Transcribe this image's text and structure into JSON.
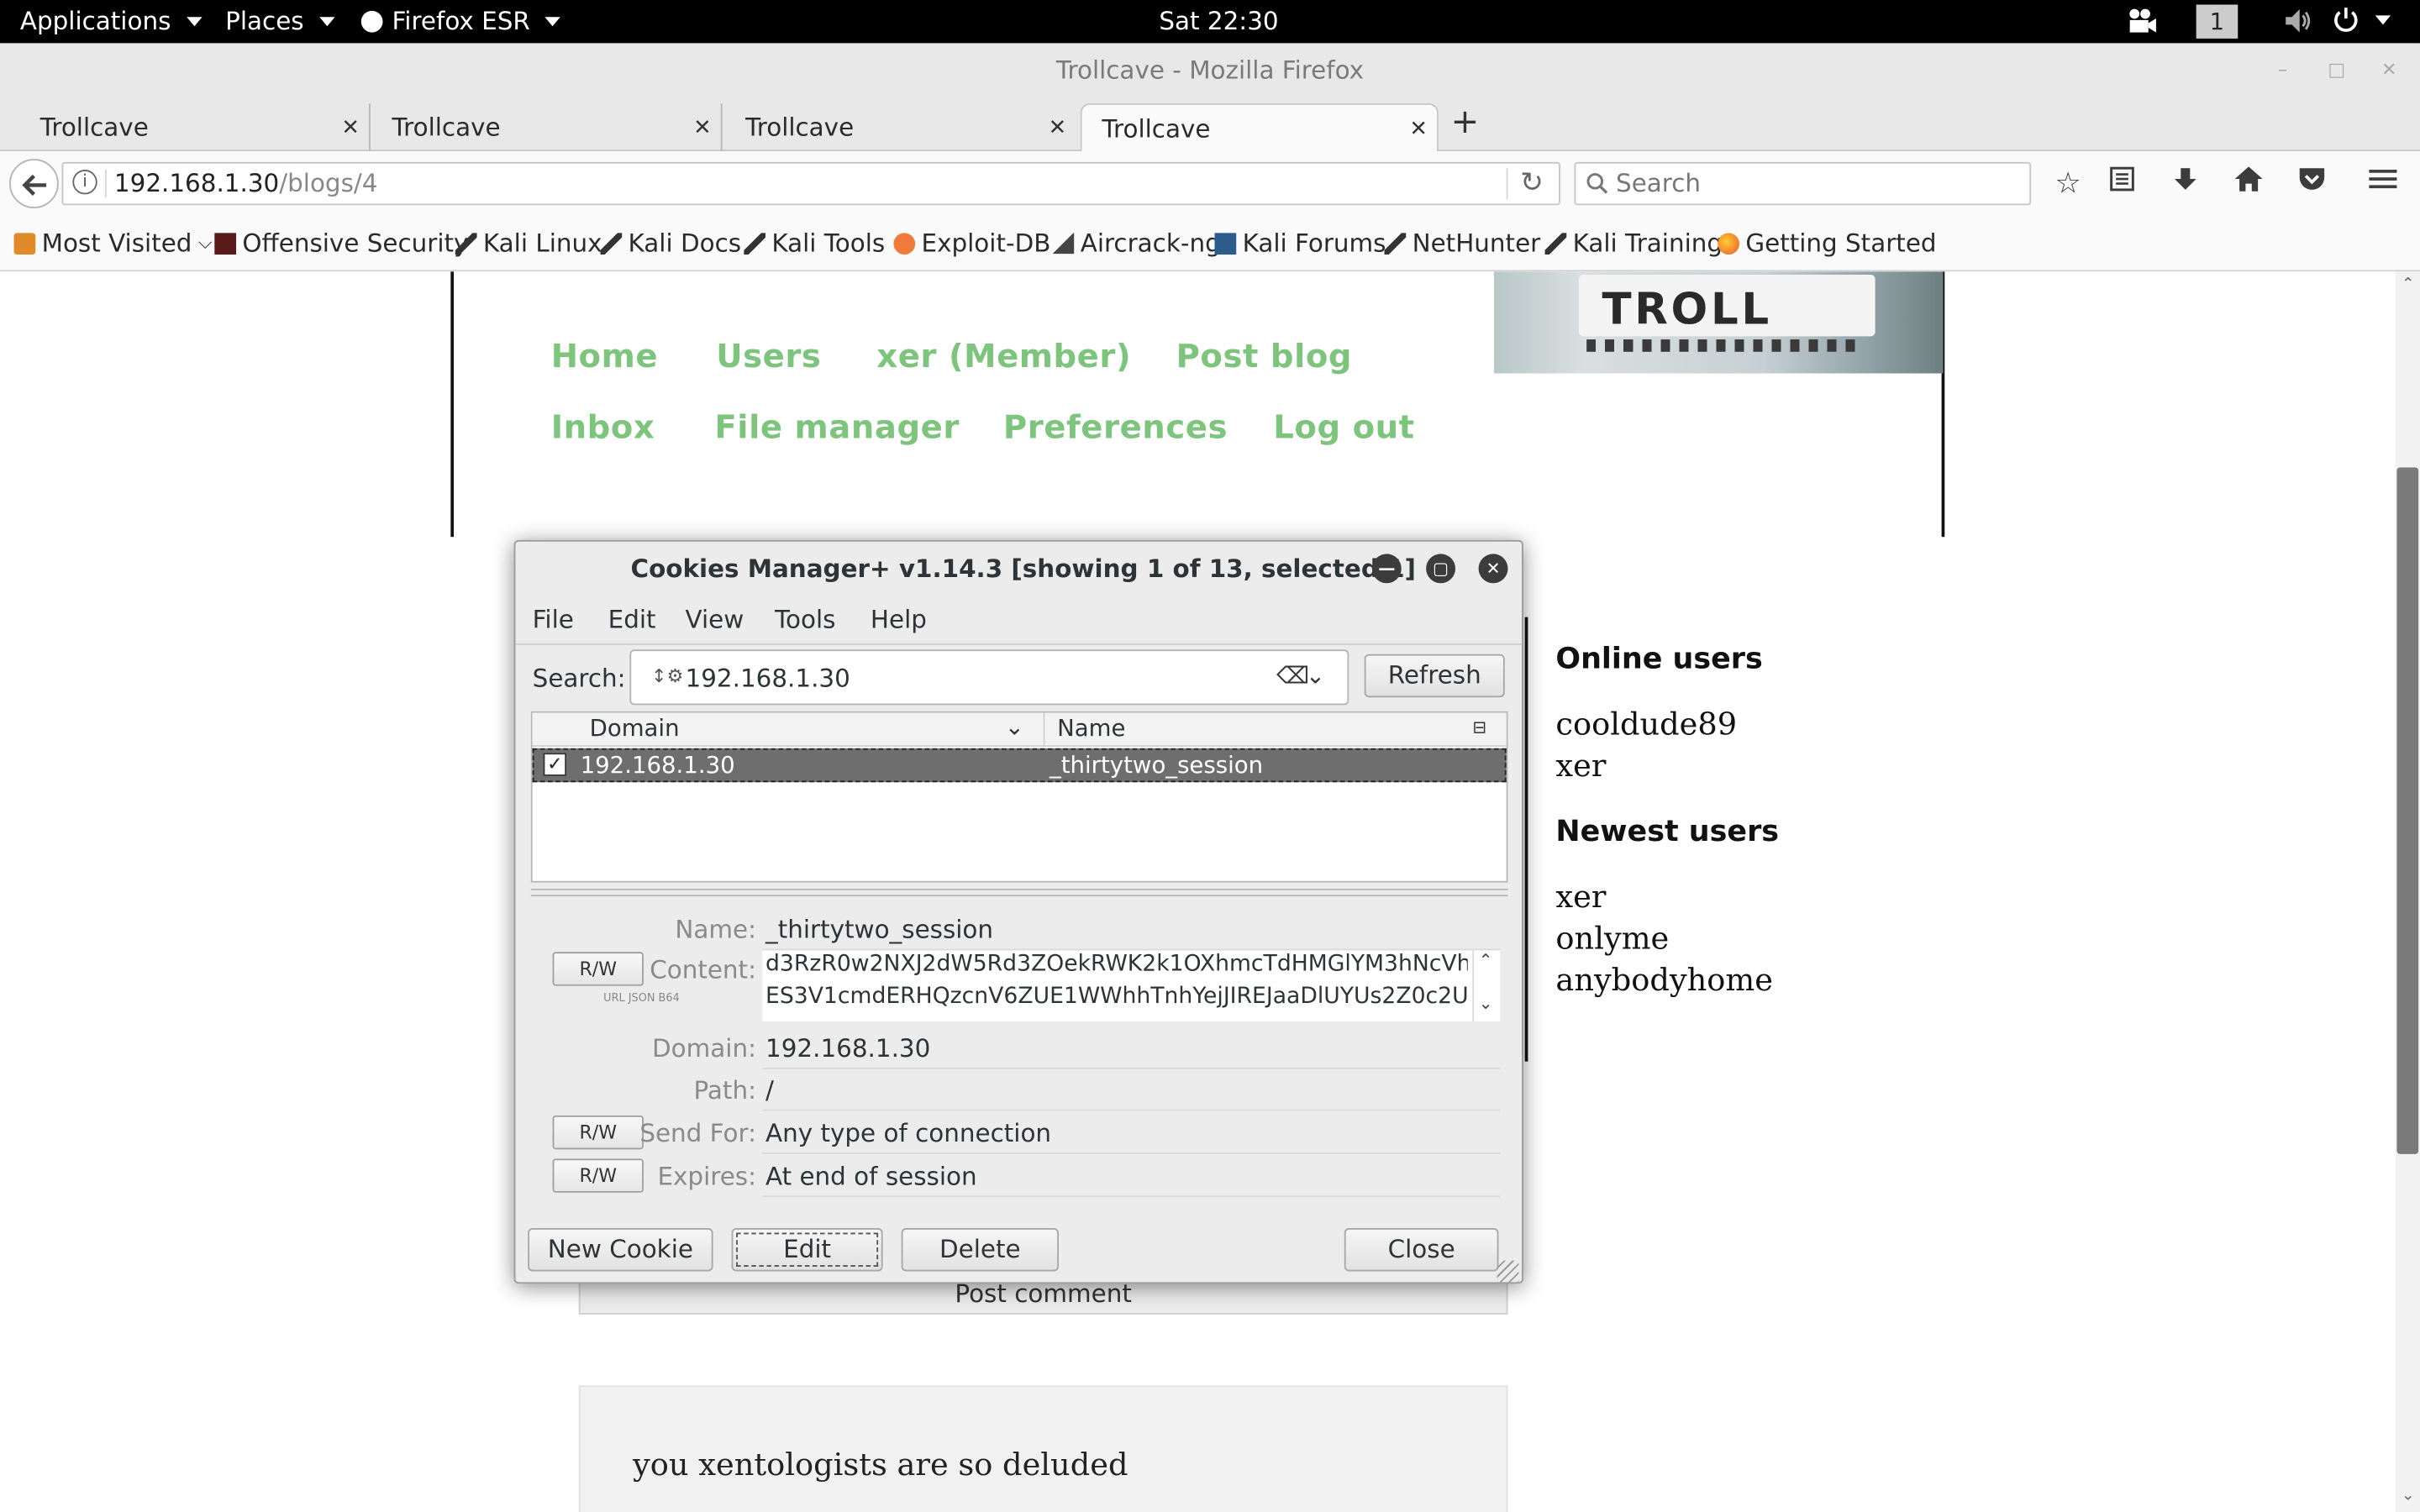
{
  "topbar": {
    "applications": "Applications",
    "places": "Places",
    "firefox": "Firefox ESR",
    "clock": "Sat 22:30",
    "workspace": "1"
  },
  "window": {
    "title": "Trollcave - Mozilla Firefox"
  },
  "tabs": [
    {
      "label": "Trollcave"
    },
    {
      "label": "Trollcave"
    },
    {
      "label": "Trollcave"
    },
    {
      "label": "Trollcave"
    }
  ],
  "navbar": {
    "url_host": "192.168.1.30",
    "url_path": "/blogs/4",
    "search_placeholder": "Search"
  },
  "bookmarks": [
    {
      "label": "Most Visited",
      "icon": "most-visited-icon"
    },
    {
      "label": "Offensive Security",
      "icon": "offsec-icon"
    },
    {
      "label": "Kali Linux",
      "icon": "kali-icon"
    },
    {
      "label": "Kali Docs",
      "icon": "kali-icon"
    },
    {
      "label": "Kali Tools",
      "icon": "kali-icon"
    },
    {
      "label": "Exploit-DB",
      "icon": "exploitdb-icon"
    },
    {
      "label": "Aircrack-ng",
      "icon": "aircrack-icon"
    },
    {
      "label": "Kali Forums",
      "icon": "kali-forums-icon"
    },
    {
      "label": "NetHunter",
      "icon": "kali-icon"
    },
    {
      "label": "Kali Training",
      "icon": "kali-icon"
    },
    {
      "label": "Getting Started",
      "icon": "firefox-icon"
    }
  ],
  "site": {
    "banner_text": "TROLL",
    "nav": {
      "home": "Home",
      "users": "Users",
      "member": "xer (Member)",
      "post_blog": "Post blog",
      "inbox": "Inbox",
      "file_manager": "File manager",
      "preferences": "Preferences",
      "logout": "Log out"
    },
    "online_heading": "Online users",
    "online_users": [
      "cooldude89",
      "xer"
    ],
    "newest_heading": "Newest users",
    "newest_users": [
      "xer",
      "onlyme",
      "anybodyhome"
    ],
    "post_comment": "Post comment",
    "comment_text": "you xentologists are so deluded"
  },
  "dialog": {
    "title": "Cookies Manager+ v1.14.3 [showing 1 of 13, selected 1]",
    "menu": [
      "File",
      "Edit",
      "View",
      "Tools",
      "Help"
    ],
    "search_label": "Search:",
    "search_value": "192.168.1.30",
    "refresh": "Refresh",
    "col_domain": "Domain",
    "col_name": "Name",
    "rows": [
      {
        "domain": "192.168.1.30",
        "name": "_thirtytwo_session",
        "checked": true
      }
    ],
    "details": {
      "name_label": "Name:",
      "name_value": "_thirtytwo_session",
      "content_label": "Content:",
      "content_line1": "d3RzR0w2NXJ2dW5Rd3ZOekRWK2k1OXhmcTdHMGlYM3hNcVh",
      "content_line2": "ES3V1cmdERHQzcnV6ZUE1WWhhTnhYejJIREJaaDlUYUs2Z0c2U",
      "encodings": "URL JSON B64",
      "domain_label": "Domain:",
      "domain_value": "192.168.1.30",
      "path_label": "Path:",
      "path_value": "/",
      "sendfor_label": "Send For:",
      "sendfor_value": "Any type of connection",
      "expires_label": "Expires:",
      "expires_value": "At end of session",
      "rw": "R/W"
    },
    "buttons": {
      "new_cookie": "New Cookie",
      "edit": "Edit",
      "delete": "Delete",
      "close": "Close"
    }
  },
  "colors": {
    "site_link": "#7dc47d",
    "selected_row": "#6e6e6e"
  }
}
